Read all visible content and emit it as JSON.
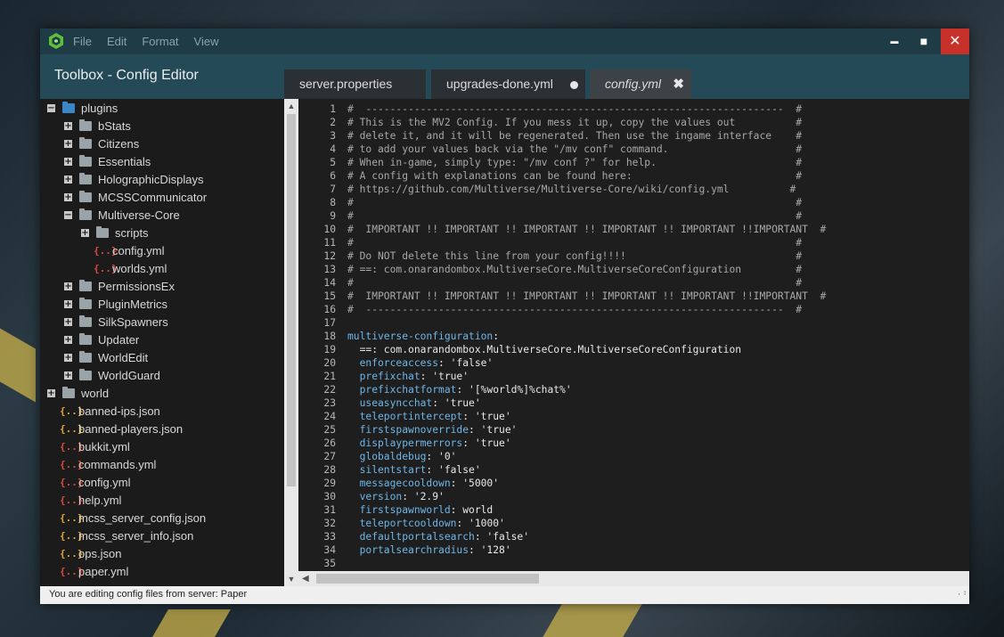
{
  "menu": [
    "File",
    "Edit",
    "Format",
    "View"
  ],
  "window_controls": {
    "minimize": "▬",
    "maximize": "■",
    "close": "✕"
  },
  "app_title": "Toolbox - Config Editor",
  "tabs": [
    {
      "label": "server.properties"
    },
    {
      "label": "upgrades-done.yml"
    },
    {
      "label": "config.yml",
      "close": "✖"
    }
  ],
  "tree": [
    {
      "label": "plugins"
    },
    {
      "label": "bStats"
    },
    {
      "label": "Citizens"
    },
    {
      "label": "Essentials"
    },
    {
      "label": "HolographicDisplays"
    },
    {
      "label": "MCSSCommunicator"
    },
    {
      "label": "Multiverse-Core"
    },
    {
      "label": "scripts"
    },
    {
      "label": "config.yml"
    },
    {
      "label": "worlds.yml"
    },
    {
      "label": "PermissionsEx"
    },
    {
      "label": "PluginMetrics"
    },
    {
      "label": "SilkSpawners"
    },
    {
      "label": "Updater"
    },
    {
      "label": "WorldEdit"
    },
    {
      "label": "WorldGuard"
    },
    {
      "label": "world"
    },
    {
      "label": "banned-ips.json"
    },
    {
      "label": "banned-players.json"
    },
    {
      "label": "bukkit.yml"
    },
    {
      "label": "commands.yml"
    },
    {
      "label": "config.yml"
    },
    {
      "label": "help.yml"
    },
    {
      "label": "mcss_server_config.json"
    },
    {
      "label": "mcss_server_info.json"
    },
    {
      "label": "ops.json"
    },
    {
      "label": "paper.yml"
    }
  ],
  "icons": {
    "yml": "{..}",
    "json": "{..}",
    "expand": "+",
    "collapse": "−"
  },
  "scroll_glyphs": {
    "up": "▲",
    "down": "▼",
    "left": "◀"
  },
  "code_lines": [
    {
      "n": "1",
      "type": "c",
      "text": "#  ---------------------------------------------------------------------  #"
    },
    {
      "n": "2",
      "type": "c",
      "text": "# This is the MV2 Config. If you mess it up, copy the values out          #"
    },
    {
      "n": "3",
      "type": "c",
      "text": "# delete it, and it will be regenerated. Then use the ingame interface    #"
    },
    {
      "n": "4",
      "type": "c",
      "text": "# to add your values back via the \"/mv conf\" command.                     #"
    },
    {
      "n": "5",
      "type": "c",
      "text": "# When in-game, simply type: \"/mv conf ?\" for help.                       #"
    },
    {
      "n": "6",
      "type": "c",
      "text": "# A config with explanations can be found here:                           #"
    },
    {
      "n": "7",
      "type": "c",
      "text": "# https://github.com/Multiverse/Multiverse-Core/wiki/config.yml          #"
    },
    {
      "n": "8",
      "type": "c",
      "text": "#                                                                         #"
    },
    {
      "n": "9",
      "type": "c",
      "text": "#                                                                         #"
    },
    {
      "n": "10",
      "type": "c",
      "text": "#  IMPORTANT !! IMPORTANT !! IMPORTANT !! IMPORTANT !! IMPORTANT !!IMPORTANT  #"
    },
    {
      "n": "11",
      "type": "c",
      "text": "#                                                                         #"
    },
    {
      "n": "12",
      "type": "c",
      "text": "# Do NOT delete this line from your config!!!!                            #"
    },
    {
      "n": "13",
      "type": "c",
      "text": "# ==: com.onarandombox.MultiverseCore.MultiverseCoreConfiguration         #"
    },
    {
      "n": "14",
      "type": "c",
      "text": "#                                                                         #"
    },
    {
      "n": "15",
      "type": "c",
      "text": "#  IMPORTANT !! IMPORTANT !! IMPORTANT !! IMPORTANT !! IMPORTANT !!IMPORTANT  #"
    },
    {
      "n": "16",
      "type": "c",
      "text": "#  ---------------------------------------------------------------------  #"
    },
    {
      "n": "17",
      "type": "c",
      "text": ""
    },
    {
      "n": "18",
      "type": "kv",
      "key": "multiverse-configuration",
      "value": ":"
    },
    {
      "n": "19",
      "type": "v",
      "text": "  ==: com.onarandombox.MultiverseCore.MultiverseCoreConfiguration"
    },
    {
      "n": "20",
      "type": "kv",
      "key": "  enforceaccess",
      "value": ": 'false'"
    },
    {
      "n": "21",
      "type": "kv",
      "key": "  prefixchat",
      "value": ": 'true'"
    },
    {
      "n": "22",
      "type": "kv",
      "key": "  prefixchatformat",
      "value": ": '[%world%]%chat%'"
    },
    {
      "n": "23",
      "type": "kv",
      "key": "  useasyncchat",
      "value": ": 'true'"
    },
    {
      "n": "24",
      "type": "kv",
      "key": "  teleportintercept",
      "value": ": 'true'"
    },
    {
      "n": "25",
      "type": "kv",
      "key": "  firstspawnoverride",
      "value": ": 'true'"
    },
    {
      "n": "26",
      "type": "kv",
      "key": "  displaypermerrors",
      "value": ": 'true'"
    },
    {
      "n": "27",
      "type": "kv",
      "key": "  globaldebug",
      "value": ": '0'"
    },
    {
      "n": "28",
      "type": "kv",
      "key": "  silentstart",
      "value": ": 'false'"
    },
    {
      "n": "29",
      "type": "kv",
      "key": "  messagecooldown",
      "value": ": '5000'"
    },
    {
      "n": "30",
      "type": "kv",
      "key": "  version",
      "value": ": '2.9'"
    },
    {
      "n": "31",
      "type": "kv",
      "key": "  firstspawnworld",
      "value": ": world"
    },
    {
      "n": "32",
      "type": "kv",
      "key": "  teleportcooldown",
      "value": ": '1000'"
    },
    {
      "n": "33",
      "type": "kv",
      "key": "  defaultportalsearch",
      "value": ": 'false'"
    },
    {
      "n": "34",
      "type": "kv",
      "key": "  portalsearchradius",
      "value": ": '128'"
    },
    {
      "n": "35",
      "type": "c",
      "text": ""
    }
  ],
  "status": "You are editing config files from server: Paper",
  "grip": "⠠⠰",
  "colors": {
    "accent_header": "#254a57",
    "titlebar": "#1f3b46",
    "close_button": "#c8312a",
    "yaml_key": "#6fb7e8",
    "yml_icon": "#e04a3c",
    "json_icon": "#e3a72a"
  }
}
